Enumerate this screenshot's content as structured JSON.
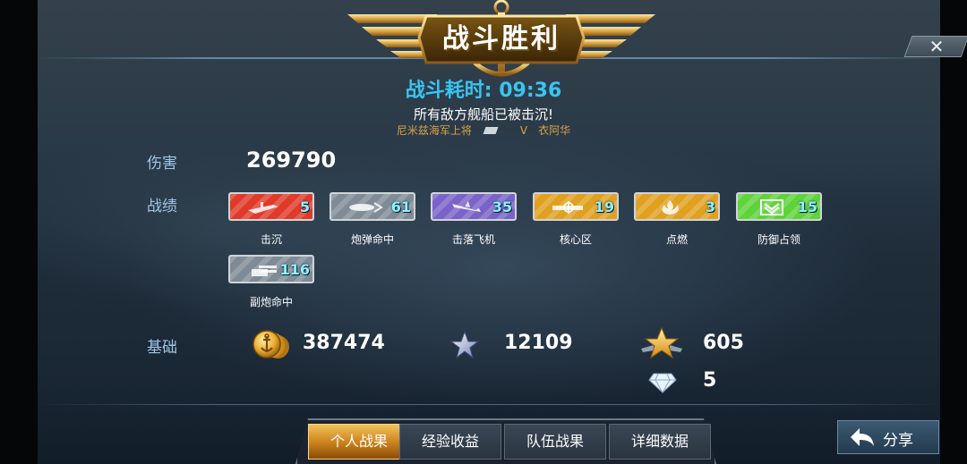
{
  "banner": {
    "title": "战斗胜利"
  },
  "close": {
    "label": "✕"
  },
  "summary": {
    "time_label": "战斗耗时:",
    "time_value": "09:36",
    "result": "所有敌方舰船已被击沉!",
    "commander_left": "尼米兹海军上将",
    "commander_rank": "V",
    "commander_right": "衣阿华"
  },
  "damage": {
    "label": "伤害",
    "value": "269790"
  },
  "achievements": {
    "label": "战绩",
    "items": [
      {
        "name": "击沉",
        "count": "5",
        "color": "#e03a2a",
        "icon": "sinking-ship-icon"
      },
      {
        "name": "炮弹命中",
        "count": "61",
        "color": "#7f8b96",
        "icon": "shell-hit-icon"
      },
      {
        "name": "击落飞机",
        "count": "35",
        "color": "#7a63c8",
        "icon": "plane-down-icon"
      },
      {
        "name": "核心区",
        "count": "19",
        "color": "#e0a020",
        "icon": "core-zone-icon"
      },
      {
        "name": "点燃",
        "count": "3",
        "color": "#e0a020",
        "icon": "fire-icon"
      },
      {
        "name": "防御占领",
        "count": "15",
        "color": "#5fd33a",
        "icon": "defense-capture-icon"
      },
      {
        "name": "副炮命中",
        "count": "116",
        "color": "#7f8b96",
        "icon": "secondary-gun-icon"
      }
    ]
  },
  "basics": {
    "label": "基础",
    "coins": "387474",
    "exp": "12109",
    "captain_exp": "605",
    "diamonds": "5"
  },
  "tabs": [
    {
      "label": "个人战果",
      "active": true
    },
    {
      "label": "经验收益",
      "active": false
    },
    {
      "label": "队伍战果",
      "active": false
    },
    {
      "label": "详细数据",
      "active": false
    }
  ],
  "share": {
    "label": "分享"
  }
}
